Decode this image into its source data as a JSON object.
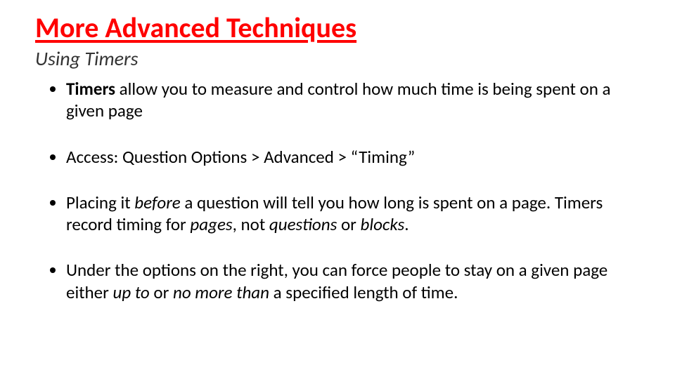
{
  "title": "More Advanced Techniques",
  "subtitle": "Using Timers",
  "bullets": {
    "b1": {
      "lead": "Timers",
      "rest": " allow you to measure and control how much time is being spent on a given page"
    },
    "b2": "Access: Question Options > Advanced > “Timing”",
    "b3": {
      "p1": "Placing it ",
      "i1": "before",
      "p2": " a question will tell you how long is spent on a page. Timers record timing for ",
      "i2": "pages",
      "p3": ", not ",
      "i3": "questions",
      "p4": " or ",
      "i4": "blocks",
      "p5": "."
    },
    "b4": {
      "p1": "Under the options on the right, you can force people to stay on a given page either ",
      "i1": "up to",
      "p2": " or ",
      "i2": "no more than",
      "p3": " a specified length of time."
    }
  }
}
